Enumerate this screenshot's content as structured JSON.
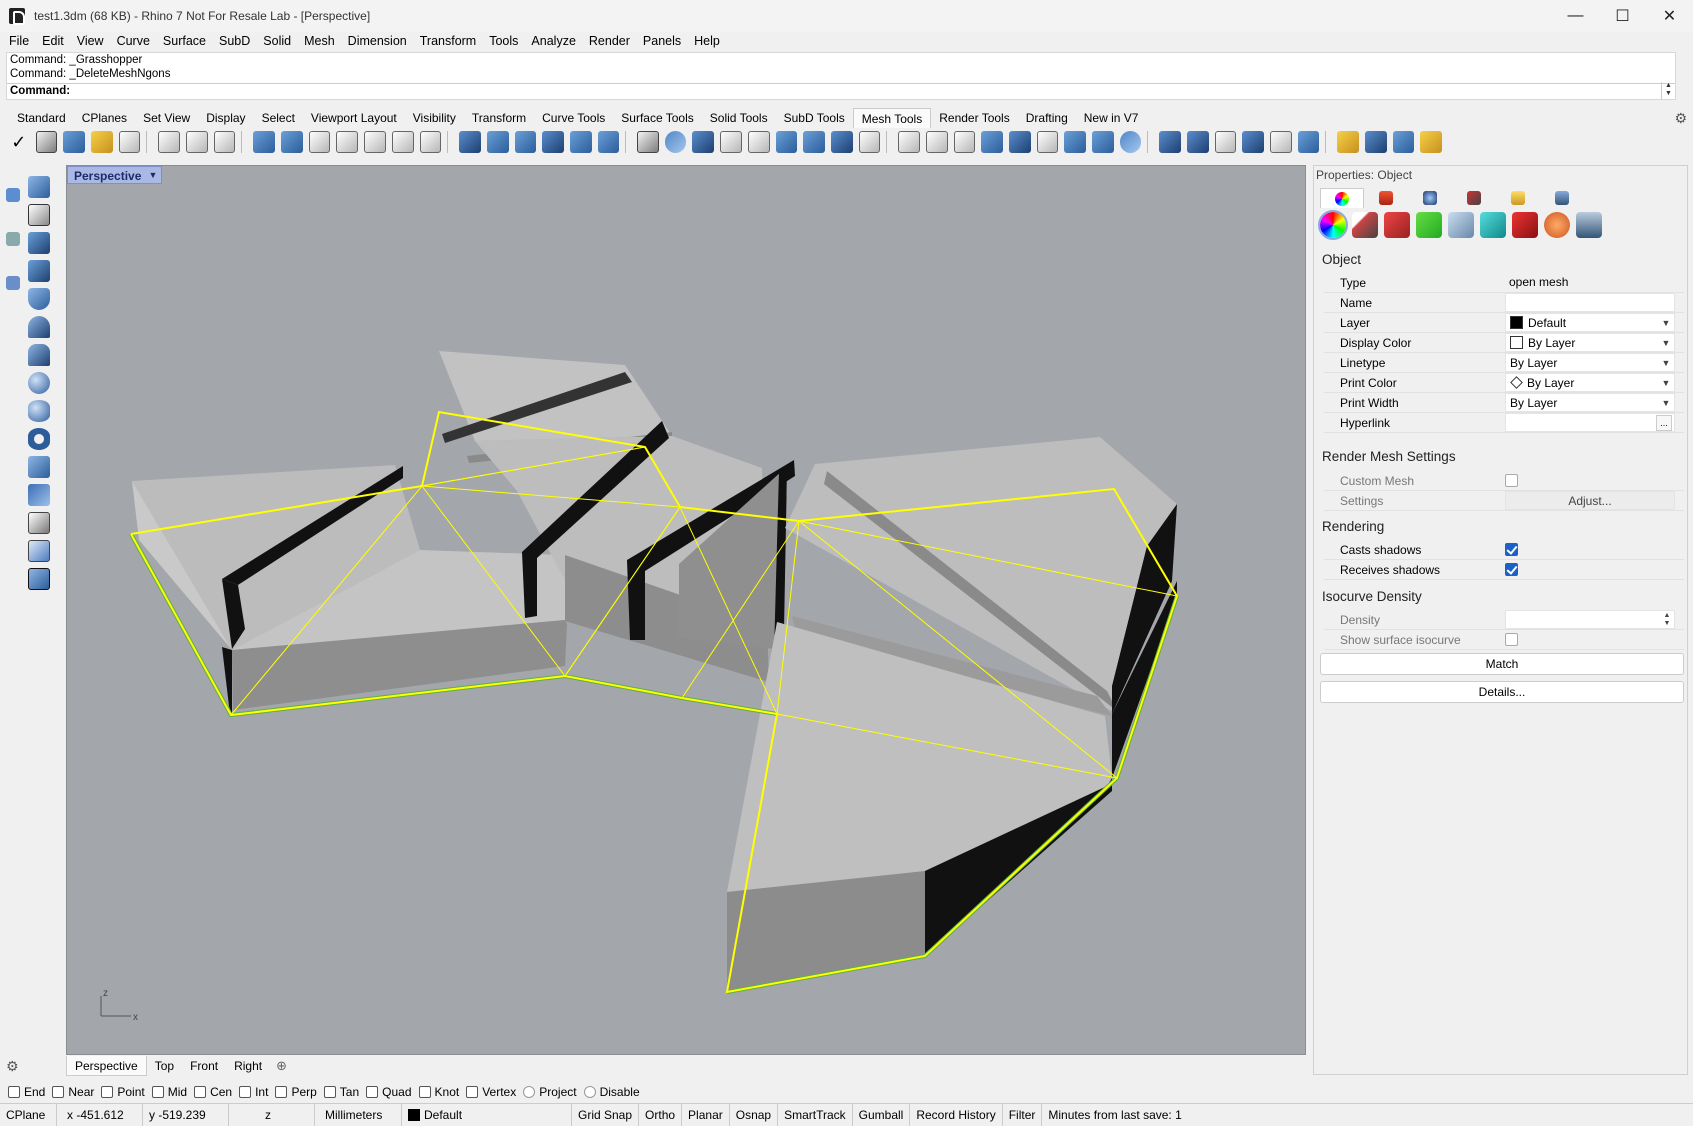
{
  "window": {
    "title": "test1.3dm (68 KB) - Rhino 7 Not For Resale Lab - [Perspective]",
    "minimize": "—",
    "maximize": "☐",
    "close": "✕"
  },
  "menu": [
    "File",
    "Edit",
    "View",
    "Curve",
    "Surface",
    "SubD",
    "Solid",
    "Mesh",
    "Dimension",
    "Transform",
    "Tools",
    "Analyze",
    "Render",
    "Panels",
    "Help"
  ],
  "command": {
    "history": [
      "Command: _Grasshopper",
      "Command: _DeleteMeshNgons"
    ],
    "prompt": "Command:"
  },
  "toolbar_tabs": [
    "Standard",
    "CPlanes",
    "Set View",
    "Display",
    "Select",
    "Viewport Layout",
    "Visibility",
    "Transform",
    "Curve Tools",
    "Surface Tools",
    "Solid Tools",
    "SubD Tools",
    "Mesh Tools",
    "Render Tools",
    "Drafting",
    "New in V7"
  ],
  "active_toolbar_tab": "Mesh Tools",
  "viewport": {
    "name": "Perspective",
    "axis_x": "x",
    "axis_z": "z"
  },
  "viewport_tabs": [
    "Perspective",
    "Top",
    "Front",
    "Right"
  ],
  "osnaps": [
    "End",
    "Near",
    "Point",
    "Mid",
    "Cen",
    "Int",
    "Perp",
    "Tan",
    "Quad",
    "Knot",
    "Vertex",
    "Project",
    "Disable"
  ],
  "status": {
    "cplane": "CPlane",
    "x": "x -451.612",
    "y": "y -519.239",
    "z": "z",
    "units": "Millimeters",
    "layer": "Default",
    "grid_snap": "Grid Snap",
    "ortho": "Ortho",
    "planar": "Planar",
    "osnap": "Osnap",
    "smarttrack": "SmartTrack",
    "gumball": "Gumball",
    "record_history": "Record History",
    "filter": "Filter",
    "save_info": "Minutes from last save: 1"
  },
  "properties": {
    "panel_title": "Properties: Object",
    "sections": {
      "object": "Object",
      "render_mesh": "Render Mesh Settings",
      "rendering": "Rendering",
      "isocurve": "Isocurve Density"
    },
    "labels": {
      "type": "Type",
      "name": "Name",
      "layer": "Layer",
      "display_color": "Display Color",
      "linetype": "Linetype",
      "print_color": "Print Color",
      "print_width": "Print Width",
      "hyperlink": "Hyperlink",
      "custom_mesh": "Custom Mesh",
      "settings": "Settings",
      "casts_shadows": "Casts shadows",
      "receives_shadows": "Receives shadows",
      "density": "Density",
      "show_surface_isocurve": "Show surface isocurve"
    },
    "values": {
      "type": "open mesh",
      "name": "",
      "layer": "Default",
      "display_color": "By Layer",
      "linetype": "By Layer",
      "print_color": "By Layer",
      "print_width": "By Layer",
      "hyperlink_button": "...",
      "adjust_button": "Adjust...",
      "casts_shadows": true,
      "receives_shadows": true,
      "custom_mesh": false,
      "show_surface_isocurve": false
    },
    "match_button": "Match",
    "details_button": "Details..."
  },
  "colors": {
    "viewport_bg": "#a3a6ab",
    "selection": "#ffff00",
    "edge_green": "#5fae4a",
    "accent_blue": "#1a62c8"
  }
}
